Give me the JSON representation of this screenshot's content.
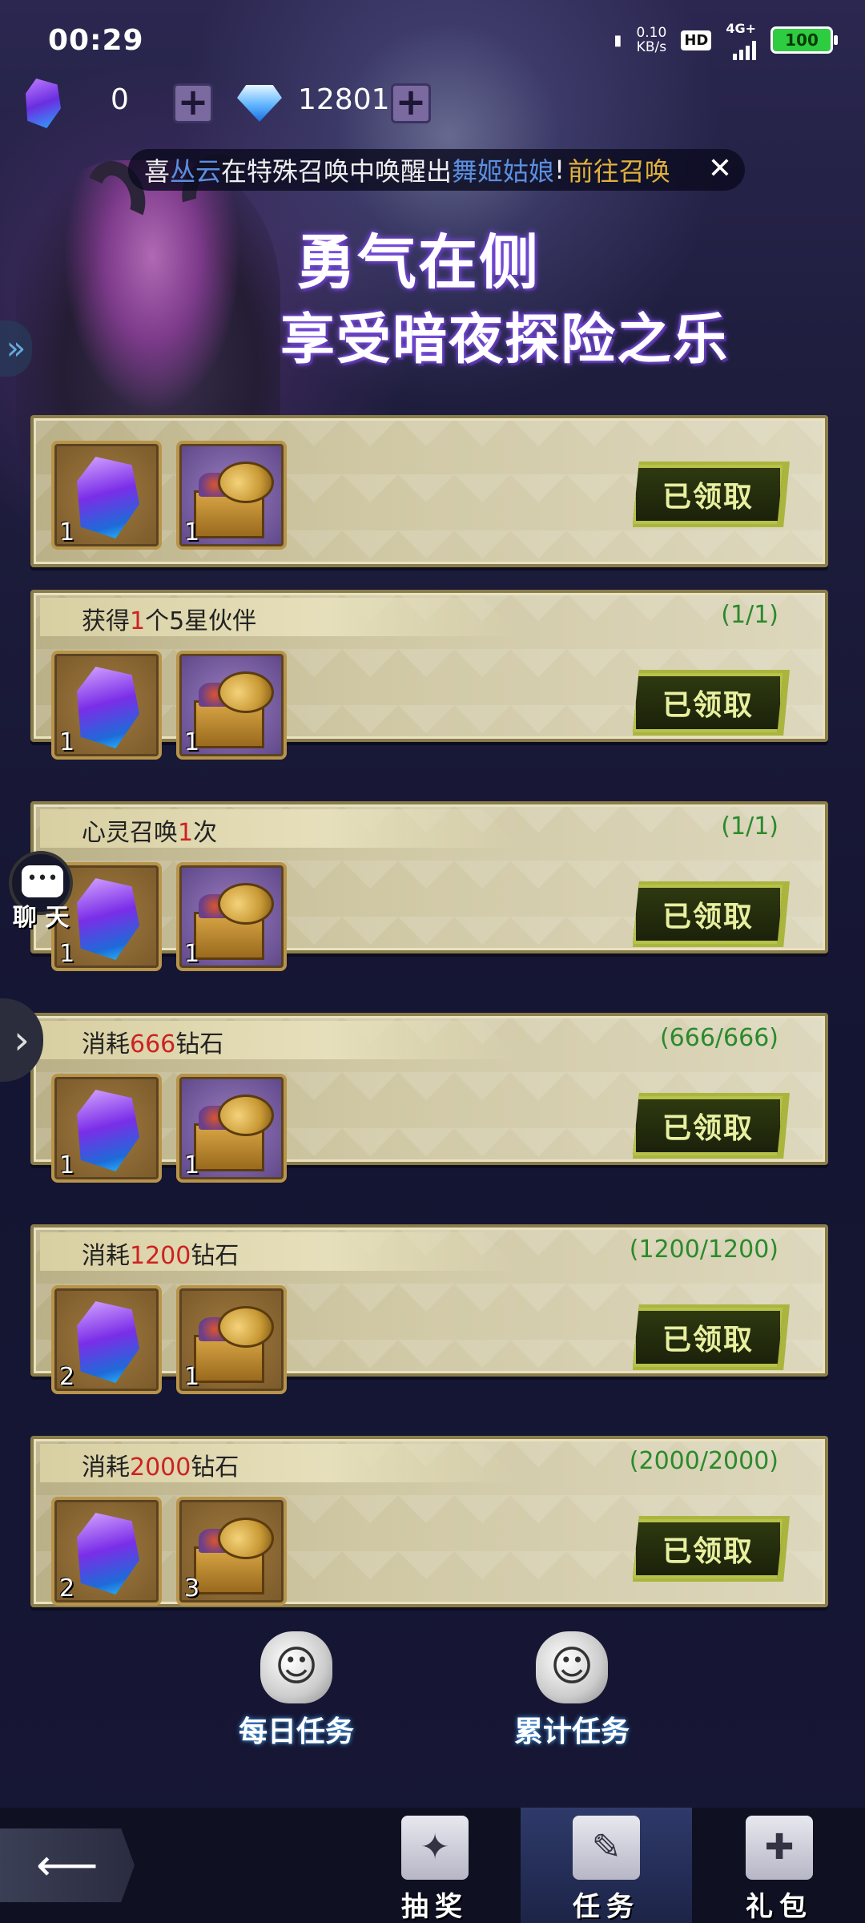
{
  "status_bar": {
    "time": "00:29",
    "net_speed_value": "0.10",
    "net_speed_unit": "KB/s",
    "hd": "HD",
    "network": "4G+",
    "battery": "100"
  },
  "currency": {
    "crystal_value": "0",
    "diamond_value": "12801"
  },
  "ticker": {
    "prefix": "喜",
    "name": "丛云",
    "mid": "在特殊召唤中唤醒出",
    "hero": "舞姬姑娘",
    "bang": "!",
    "goto": "前往召唤"
  },
  "banner": {
    "line1": "勇气在侧",
    "line2": "享受暗夜探险之乐"
  },
  "tasks": [
    {
      "title_pre": "",
      "title_num": "",
      "title_post": "",
      "progress": "",
      "crystal_count": "1",
      "chest_count": "1",
      "claimed": "已领取"
    },
    {
      "title_pre": "获得",
      "title_num": "1",
      "title_post": "个5星伙伴",
      "progress": "(1/1)",
      "crystal_count": "1",
      "chest_count": "1",
      "claimed": "已领取"
    },
    {
      "title_pre": "心灵召唤",
      "title_num": "1",
      "title_post": "次",
      "progress": "(1/1)",
      "crystal_count": "1",
      "chest_count": "1",
      "claimed": "已领取"
    },
    {
      "title_pre": "消耗",
      "title_num": "666",
      "title_post": "钻石",
      "progress": "(666/666)",
      "crystal_count": "1",
      "chest_count": "1",
      "claimed": "已领取"
    },
    {
      "title_pre": "消耗",
      "title_num": "1200",
      "title_post": "钻石",
      "progress": "(1200/1200)",
      "crystal_count": "2",
      "chest_count": "1",
      "claimed": "已领取"
    },
    {
      "title_pre": "消耗",
      "title_num": "2000",
      "title_post": "钻石",
      "progress": "(2000/2000)",
      "crystal_count": "2",
      "chest_count": "3",
      "claimed": "已领取"
    }
  ],
  "chat": {
    "label": "聊 天"
  },
  "sub_tabs": {
    "daily": "每日任务",
    "cumulative": "累计任务"
  },
  "nav": {
    "draw": "抽奖",
    "task": "任务",
    "gift": "礼包"
  },
  "colors": {
    "progress_green": "#2b8a2b",
    "highlight_red": "#c22",
    "ticker_blue": "#5b8fe0",
    "ticker_gold": "#e0b23a"
  }
}
